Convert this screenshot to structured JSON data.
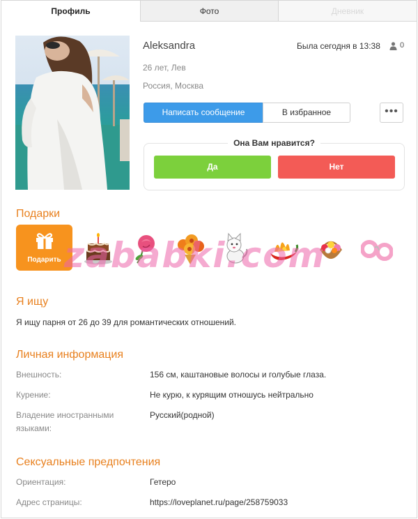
{
  "tabs": {
    "profile": "Профиль",
    "photo": "Фото",
    "diary": "Дневник"
  },
  "profile": {
    "name": "Aleksandra",
    "last_seen": "Была сегодня в 13:38",
    "visits_count": "0",
    "age_sign": "26 лет, Лев",
    "location": "Россия, Москва"
  },
  "actions": {
    "message_label": "Написать сообщение",
    "favorite_label": "В избранное",
    "more_label": "•••"
  },
  "like": {
    "question": "Она Вам нравится?",
    "yes_label": "Да",
    "no_label": "Нет"
  },
  "gifts": {
    "title": "Подарки",
    "button_label": "Подарить",
    "items": [
      "cake-gift",
      "rose-gift",
      "bouquet-gift",
      "kitten-gift",
      "pepper-gift",
      "flower-basket-gift",
      "fluffy-handcuffs-gift"
    ],
    "watermark": "zababki.com"
  },
  "seeking": {
    "title": "Я ищу",
    "text": "Я ищу парня от 26 до 39 для романтических отношений."
  },
  "personal": {
    "title": "Личная информация",
    "appearance_label": "Внешность:",
    "appearance_value": "156 см, каштановые волосы и голубые глаза.",
    "smoking_label": "Курение:",
    "smoking_value": "Не курю, к курящим отношусь нейтрально",
    "languages_label": "Владение иностранными языками:",
    "languages_value": "Русский(родной)"
  },
  "sexual": {
    "title": "Сексуальные предпочтения",
    "orientation_label": "Ориентация:",
    "orientation_value": "Гетеро",
    "address_label": "Адрес страницы:",
    "address_value": "https://loveplanet.ru/page/258759033"
  },
  "colors": {
    "accent_orange": "#e8801e",
    "primary_blue": "#3d9be9",
    "yes_green": "#7cd03c",
    "no_red": "#f35b56",
    "watermark_pink": "#ec64aa"
  }
}
